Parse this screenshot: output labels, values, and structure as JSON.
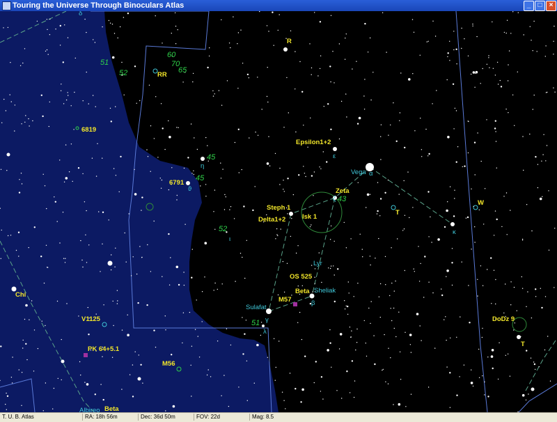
{
  "window": {
    "title": "Touring the Universe Through Binoculars Atlas"
  },
  "window_controls": {
    "minimize": "_",
    "maximize": "□",
    "close": "×"
  },
  "status": {
    "app": "T. U. B. Atlas",
    "ra": "RA: 18h 56m",
    "dec": "Dec: 36d 50m",
    "fov": "FOV: 22d",
    "mag": "Mag: 8.5"
  },
  "map_labels": {
    "R": "R",
    "RR": "RR",
    "m60": "60",
    "m70": "70",
    "m65": "65",
    "m51a": "51",
    "m52a": "52",
    "delta_top": "δ",
    "ngc6819": "6819",
    "epsilon": "Epsilon1+2",
    "epsilon_greek": "ε",
    "vega": "Vega",
    "alpha": "α",
    "eta": "η",
    "m45a": "45",
    "ngc6791": "6791",
    "m45b": "45",
    "theta": "ϑ",
    "zeta": "Zeta",
    "zeta_greek": "ζ",
    "m43": "43",
    "steph1": "Steph 1",
    "delta12": "Delta1+2",
    "isk1": "Isk 1",
    "T1": "T",
    "W": "W",
    "kappa": "κ",
    "m52b": "52",
    "iota": "ι",
    "lyr": "Lyr",
    "os525": "OS 525",
    "beta": "Beta",
    "sheliak": "Sheliak",
    "beta_greek": "β",
    "m57": "M57",
    "sulafat": "Sulafat",
    "gamma": "γ",
    "m51b": "51",
    "lambda": "λ",
    "chi": "Chi",
    "v1125": "V1125",
    "pk": "PK 64+5.1",
    "m56": "M56",
    "dodz9": "DoDz 9",
    "T2": "T",
    "albireo": "Albireo",
    "beta_bottom": "Beta"
  },
  "colors": {
    "milky_way": "#0c1a63",
    "sky": "#000000",
    "constellation_line": "#5aa38a",
    "boundary": "#5a7ad8",
    "label_yellow": "#f2e62a",
    "label_cyan": "#3fc7d8",
    "label_green": "#2fd24a"
  }
}
